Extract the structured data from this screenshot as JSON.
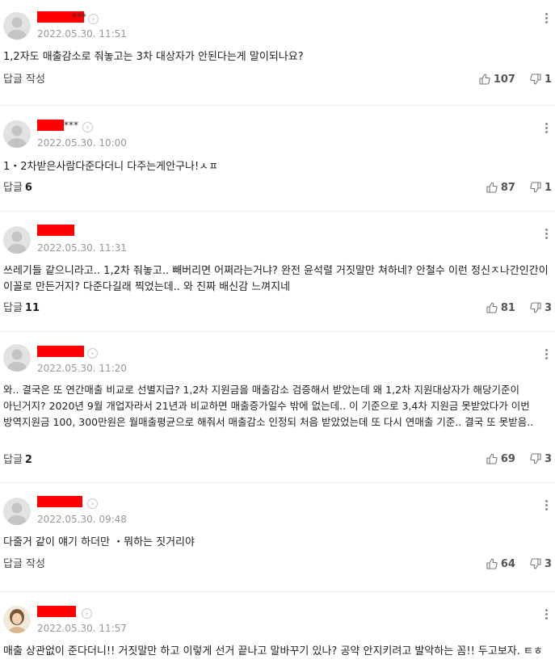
{
  "comments": [
    {
      "name_suffix": "***",
      "timestamp": "2022.05.30. 11:51",
      "body": "1,2자도 매출감소로 줘놓고는 3차 대상자가 안된다는게 말이되나요?",
      "reply_label": "답글 작성",
      "reply_count": "",
      "likes": "107",
      "dislikes": "1",
      "avatar": "default-avatar-icon"
    },
    {
      "name_suffix": "***",
      "timestamp": "2022.05.30. 10:00",
      "body": "1・2차받은사람다준다더니 다주는게안구나!ㅅㅍ",
      "reply_label": "답글",
      "reply_count": "6",
      "likes": "87",
      "dislikes": "1",
      "avatar": "default-avatar-icon"
    },
    {
      "name_suffix": "",
      "timestamp": "2022.05.30. 11:31",
      "body": "쓰레기들 같으니라고.. 1,2차 줘놓고.. 빼버리면 어쩌라는거냐? 완전 윤석렬 거짓말만 쳐하네? 안철수 이런 정신ㅈ나간인간이 이꼴로 만든거지? 다준다길래 찍었는데.. 와 진짜 배신감 느껴지네",
      "reply_label": "답글",
      "reply_count": "11",
      "likes": "81",
      "dislikes": "3",
      "avatar": "default-avatar-icon"
    },
    {
      "name_suffix": "",
      "timestamp": "2022.05.30. 11:20",
      "body": "와.. 결국은 또 연간매출 비교로 선별지급? 1,2차 지원금을 매출감소 검증해서 받았는데 왜 1,2차 지원대상자가 해당기준이 아닌거지? 2020년 9월 개업자라서 21년과 비교하면 매출증가일수 밖에 없는데.. 이 기준으로 3,4차 지원금 못받았다가 이번 방역지원금 100, 300만원은 월매출평균으로 해줘서 매출감소 인정되 처음 받았었는데 또 다시 연매출 기준.. 결국 또 못받음..",
      "reply_label": "답글",
      "reply_count": "2",
      "likes": "69",
      "dislikes": "3",
      "avatar": "default-avatar-icon"
    },
    {
      "name_suffix": "",
      "timestamp": "2022.05.30. 09:48",
      "body": "다줄거 같이 얘기 하더만 ・뭐하는 짓거리야",
      "reply_label": "답글 작성",
      "reply_count": "",
      "likes": "64",
      "dislikes": "3",
      "avatar": "default-avatar-icon"
    },
    {
      "name_suffix": "",
      "timestamp": "2022.05.30. 11:57",
      "body": "매출 상관없이 준다더니!! 거짓말만 하고 이렇게 선거 끝나고 말바꾸기 있나? 공약 안지키려고 발악하는 꼼!! 두고보자. ㅌㅎ",
      "reply_label": "",
      "reply_count": "",
      "likes": "",
      "dislikes": "",
      "avatar": "profile-photo"
    }
  ],
  "icons": {
    "like": "thumbs-up-icon",
    "dislike": "thumbs-down-icon",
    "more": "more-vertical-icon",
    "profile_arrow": "chevron-right-icon"
  },
  "colors": {
    "redaction": "#ff0000",
    "timestamp": "#999999",
    "divider": "#ebebeb"
  }
}
